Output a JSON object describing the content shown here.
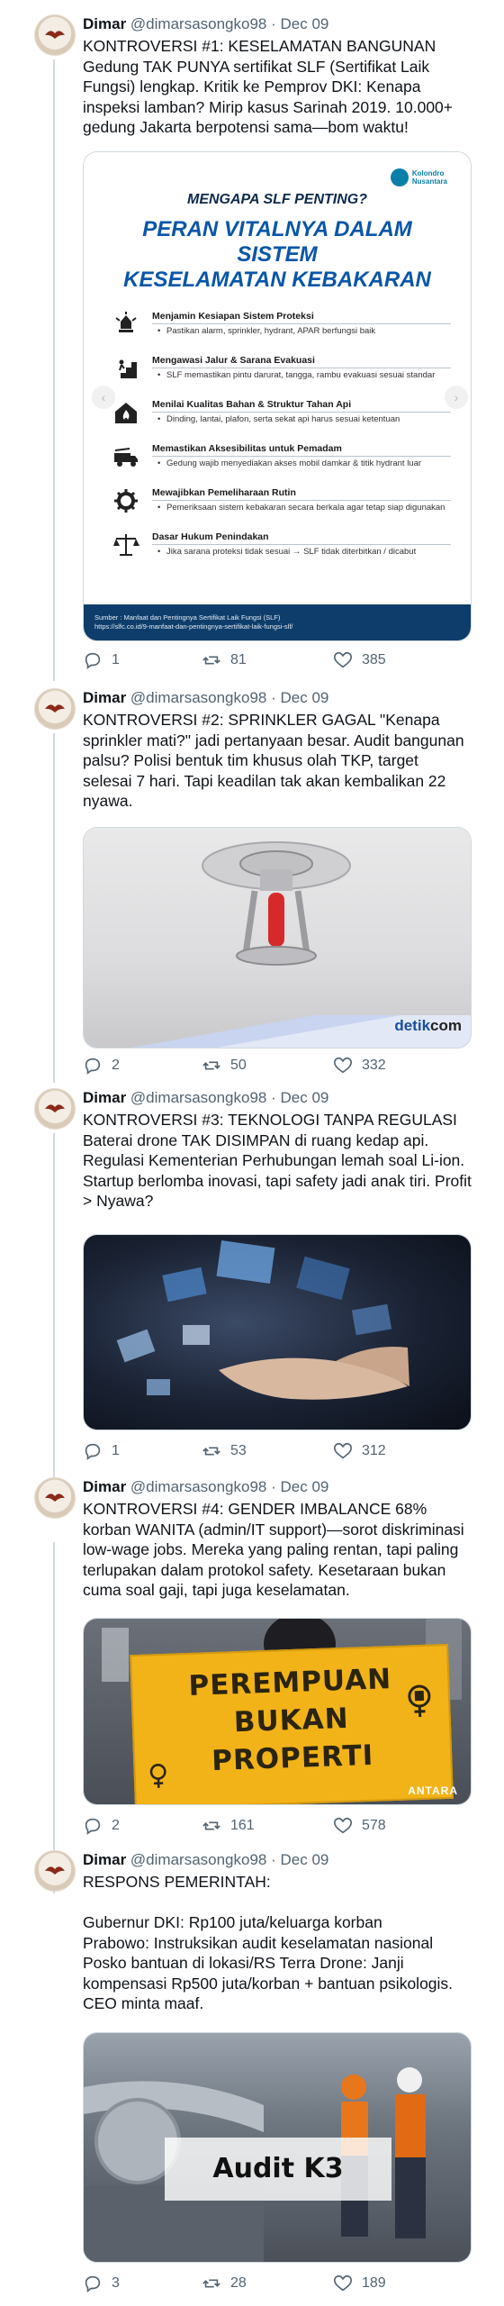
{
  "author": {
    "name": "Dimar",
    "handle": "@dimarsasongko98",
    "separator": "·"
  },
  "tweets": [
    {
      "date": "Dec 09",
      "text": "KONTROVERSI #1: KESELAMATAN BANGUNAN Gedung TAK PUNYA sertifikat SLF (Sertifikat Laik Fungsi) lengkap. Kritik ke Pemprov DKI: Kenapa inspeksi lamban? Mirip kasus Sarinah 2019. 10.000+ gedung Jakarta berpotensi sama—bom waktu!",
      "replies": "1",
      "retweets": "81",
      "likes": "385"
    },
    {
      "date": "Dec 09",
      "text": "KONTROVERSI #2: SPRINKLER GAGAL \"Kenapa sprinkler mati?\" jadi pertanyaan besar. Audit bangunan palsu? Polisi bentuk tim khusus olah TKP, target selesai 7 hari. Tapi keadilan tak akan kembalikan 22 nyawa.",
      "replies": "2",
      "retweets": "50",
      "likes": "332"
    },
    {
      "date": "Dec 09",
      "text": "KONTROVERSI #3: TEKNOLOGI TANPA REGULASI Baterai drone TAK DISIMPAN di ruang kedap api. Regulasi Kementerian Perhubungan lemah soal Li-ion. Startup berlomba inovasi, tapi safety jadi anak tiri. Profit > Nyawa?",
      "replies": "1",
      "retweets": "53",
      "likes": "312"
    },
    {
      "date": "Dec 09",
      "text": "KONTROVERSI #4: GENDER IMBALANCE 68% korban WANITA (admin/IT support)—sorot diskriminasi low-wage jobs. Mereka yang paling rentan, tapi paling terlupakan dalam protokol safety. Kesetaraan bukan cuma soal gaji, tapi juga keselamatan.",
      "replies": "2",
      "retweets": "161",
      "likes": "578"
    },
    {
      "date": "Dec 09",
      "text": "RESPONS PEMERINTAH:\n\nGubernur DKI: Rp100 juta/keluarga korban\nPrabowo: Instruksikan audit keselamatan nasional\nPosko bantuan di lokasi/RS Terra Drone: Janji kompensasi Rp500 juta/korban + bantuan psikologis. CEO minta maaf.",
      "replies": "3",
      "retweets": "28",
      "likes": "189"
    }
  ],
  "infographic": {
    "question": "MENGAPA SLF PENTING?",
    "headline_1": "PERAN VITALNYA DALAM SISTEM",
    "headline_2": "KESELAMATAN KEBAKARAN",
    "logo_line1": "Kolondro",
    "logo_line2": "Nusantara",
    "items": [
      {
        "title": "Menjamin Kesiapan Sistem Proteksi",
        "desc": "Pastikan alarm, sprinkler, hydrant, APAR berfungsi baik",
        "icon": "alarm-bell-icon"
      },
      {
        "title": "Mengawasi Jalur & Sarana Evakuasi",
        "desc": "SLF memastikan pintu darurat, tangga, rambu evakuasi sesuai standar",
        "icon": "evacuation-stairs-icon"
      },
      {
        "title": "Menilai Kualitas Bahan & Struktur Tahan Api",
        "desc": "Dinding, lantai, plafon, serta sekat api harus sesuai ketentuan",
        "icon": "fire-building-icon"
      },
      {
        "title": "Memastikan Aksesibilitas untuk Pemadam",
        "desc": "Gedung wajib menyediakan akses mobil damkar & titik hydrant luar",
        "icon": "fire-truck-icon"
      },
      {
        "title": "Mewajibkan Pemeliharaan Rutin",
        "desc": "Pemeriksaan sistem kebakaran secara berkala agar tetap siap digunakan",
        "icon": "maintenance-gear-icon"
      },
      {
        "title": "Dasar Hukum Penindakan",
        "desc": "Jika sarana proteksi tidak sesuai → SLF tidak diterbitkan / dicabut",
        "icon": "justice-scale-icon"
      }
    ],
    "source_line1": "Sumber : Manfaat dan Pentingnya Sertifikat Laik Fungsi (SLF)",
    "source_line2": "https://slfc.co.id/9-manfaat-dan-pentingnya-sertifikat-laik-fungsi-slf/"
  },
  "media": {
    "detik_watermark_a": "detik",
    "detik_watermark_b": "com",
    "protest_sign_line1": "PEREMPUAN",
    "protest_sign_line2": "BUKAN",
    "protest_sign_line3": "PROPERTI",
    "antara_watermark": "ANTARA",
    "audit_label": "Audit K3"
  },
  "colors": {
    "text": "#0f1419",
    "secondary": "#536471",
    "thread_line": "#cfd9de",
    "infographic_blue": "#0a56a8",
    "infographic_navy": "#0e3d6b"
  }
}
